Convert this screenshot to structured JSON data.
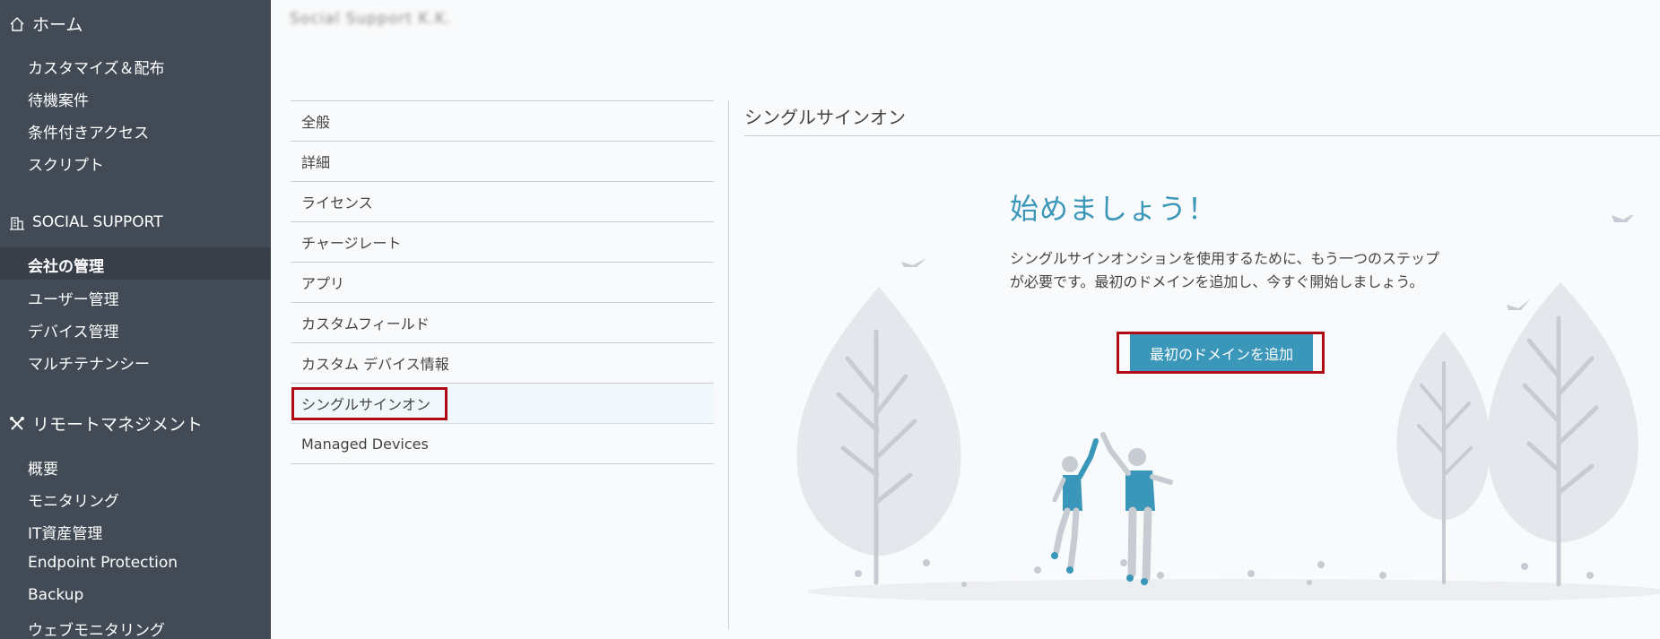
{
  "app": {
    "account_title": "Social Support K.K."
  },
  "sidebar": {
    "home": {
      "label": "ホーム",
      "icon": "home-icon"
    },
    "home_items": [
      {
        "label": "カスタマイズ＆配布"
      },
      {
        "label": "待機案件"
      },
      {
        "label": "条件付きアクセス"
      },
      {
        "label": "スクリプト"
      }
    ],
    "company": {
      "label": "SOCIAL SUPPORT",
      "icon": "building-icon"
    },
    "company_items": [
      {
        "label": "会社の管理",
        "active": true
      },
      {
        "label": "ユーザー管理"
      },
      {
        "label": "デバイス管理"
      },
      {
        "label": "マルチテナンシー"
      }
    ],
    "remote": {
      "label": "リモートマネジメント",
      "icon": "tools-icon"
    },
    "remote_items": [
      {
        "label": "概要"
      },
      {
        "label": "モニタリング"
      },
      {
        "label": "IT資産管理"
      },
      {
        "label": "Endpoint Protection"
      },
      {
        "label": "Backup"
      },
      {
        "label": "ウェブモニタリング"
      }
    ]
  },
  "settings_menu": [
    {
      "label": "全般"
    },
    {
      "label": "詳細"
    },
    {
      "label": "ライセンス"
    },
    {
      "label": "チャージレート"
    },
    {
      "label": "アプリ"
    },
    {
      "label": "カスタムフィールド"
    },
    {
      "label": "カスタム デバイス情報"
    },
    {
      "label": "シングルサインオン",
      "selected": true
    },
    {
      "label": "Managed Devices"
    }
  ],
  "panel": {
    "title": "シングルサインオン",
    "heading": "始めましょう！",
    "description": "シングルサインオンションを使用するために、もう一つのステップが必要です。最初のドメインを追加し、今すぐ開始しましょう。",
    "add_domain_button": "最初のドメインを追加"
  },
  "colors": {
    "sidebar_bg": "#414a55",
    "accent": "#3b97b9",
    "highlight_border": "#b00c15"
  }
}
